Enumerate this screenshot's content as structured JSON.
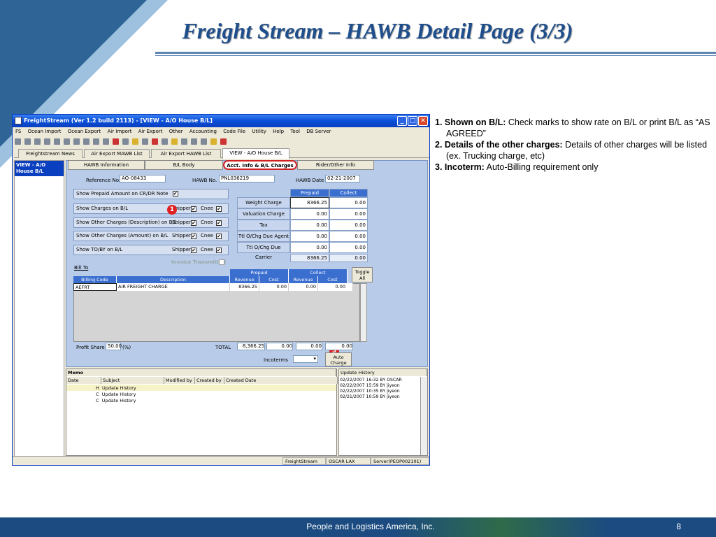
{
  "slide": {
    "title": "Freight Stream – HAWB Detail Page (3/3)",
    "footer": "People and Logistics America, Inc.",
    "page_number": "8"
  },
  "notes": [
    {
      "label": "1. Shown on B/L:",
      "text": " Check marks to show rate on B/L or print B/L as “AS AGREED”"
    },
    {
      "label": "2. Details of the other charges:",
      "text": " Details of other charges will be listed (ex. Trucking charge, etc)"
    },
    {
      "label": "3. Incoterm:",
      "text": " Auto-Billing requirement only"
    }
  ],
  "window": {
    "title": "FreightStream (Ver 1.2 build 2113) - [VIEW - A/O House B/L]",
    "menu": [
      "FS",
      "Ocean Import",
      "Ocean Export",
      "Air Import",
      "Air Export",
      "Other",
      "Accounting",
      "Code File",
      "Utility",
      "Help",
      "Tool",
      "DB Server"
    ],
    "top_tabs": [
      "Freightstream News",
      "Air Export MAWB List",
      "Air Export HAWB List",
      "VIEW - A/O House B/L"
    ],
    "left_item": "VIEW - A/O House B/L",
    "sub_tabs": [
      "HAWB Information",
      "B/L Body",
      "Acct. Info & B/L Charges",
      "Rider/Other Info"
    ]
  },
  "header_fields": {
    "reference_label": "Reference No.",
    "reference_value": "AO-08433",
    "hawb_label": "HAWB No.",
    "hawb_value": "PNL036219",
    "date_label": "HAWB Date",
    "date_value": "02-21-2007"
  },
  "options": [
    {
      "label": "Show Prepaid Amount on CR/DR Note",
      "shipper": "",
      "cnee": ""
    },
    {
      "label": "Show Charges on B/L",
      "shipper": "Shipper",
      "cnee": "Cnee"
    },
    {
      "label": "Show Other Charges (Description) on B/L",
      "shipper": "Shipper",
      "cnee": "Cnee"
    },
    {
      "label": "Show Other Charges (Amount) on B/L",
      "shipper": "Shipper",
      "cnee": "Cnee"
    },
    {
      "label": "Show TO/BY  on B/L",
      "shipper": "Shipper",
      "cnee": "Cnee"
    }
  ],
  "invoice_transmitted": "Invoice Transmitted",
  "charges_grid": {
    "headers": [
      "Prepaid",
      "Collect"
    ],
    "rows": [
      {
        "label": "Weight Charge",
        "prepaid": "8366.25",
        "collect": "0.00"
      },
      {
        "label": "Valuation Charge",
        "prepaid": "0.00",
        "collect": "0.00"
      },
      {
        "label": "Tax",
        "prepaid": "0.00",
        "collect": "0.00"
      },
      {
        "label": "Ttl O/Chg Due Agent",
        "prepaid": "0.00",
        "collect": "0.00"
      },
      {
        "label": "Ttl O/Chg Due Carrier",
        "prepaid": "0.00",
        "collect": "0.00"
      }
    ],
    "total_prepaid": "8366.25",
    "total_collect": "0.00"
  },
  "billing": {
    "bill_to": "Bill To",
    "group_prepaid": "Prepaid",
    "group_collect": "Collect",
    "toggle": "Toggle All",
    "cols": [
      "Billing Code",
      "Description",
      "Revenue",
      "Cost",
      "Revenue",
      "Cost"
    ],
    "row": {
      "code": "AEFRT",
      "desc": "AIR FREIGHT CHARGE",
      "p_rev": "8366.25",
      "p_cost": "0.00",
      "c_rev": "0.00",
      "c_cost": "0.00"
    }
  },
  "summary": {
    "profit_label": "Profit Share",
    "profit_value": "50.00",
    "profit_unit": "(%)",
    "total_label": "TOTAL",
    "t1": "8,366.25",
    "t2": "0.00",
    "t3": "0.00",
    "t4": "0.00",
    "incoterms_label": "Incoterms",
    "auto_charge": "Auto Charge"
  },
  "markers": [
    "1",
    "2",
    "3"
  ],
  "memo": {
    "title": "Memo",
    "cols": [
      "Date",
      "Subject",
      "Modified by",
      "Created by",
      "Created Date"
    ],
    "rows": [
      {
        "flag": "H",
        "subject": "Update History"
      },
      {
        "flag": "C",
        "subject": "Update History"
      },
      {
        "flag": "C",
        "subject": "Update History"
      }
    ]
  },
  "update_history": {
    "title": "Update History",
    "entries": [
      "02/22/2007 16:32  BY OSCAR",
      "02/22/2007 15:59  BY jiyeon",
      "02/22/2007 10:35  BY jiyeon",
      "02/21/2007 10:59  BY jiyeon"
    ]
  },
  "status": [
    "FreightStream",
    "OSCAR LAX",
    "Server(PEOP002101)"
  ]
}
